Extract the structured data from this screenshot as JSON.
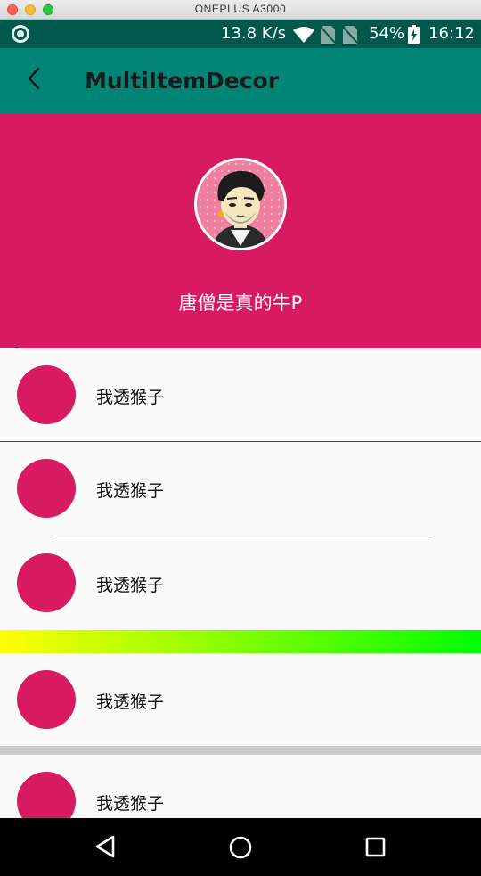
{
  "window": {
    "title": "ONEPLUS A3000"
  },
  "status_bar": {
    "net_speed": "13.8 K/s",
    "battery_percent": "54%",
    "time": "16:12",
    "icons": [
      "record-icon",
      "wifi-icon",
      "sim-off-icon",
      "sim-off-icon",
      "battery-charging-icon"
    ]
  },
  "app_bar": {
    "title": "MultiItemDecor",
    "back_icon": "chevron-left-icon"
  },
  "header": {
    "name": "唐僧是真的牛P",
    "avatar_icon": "cartoon-avatar"
  },
  "list": {
    "items": [
      {
        "label": "我透猴子"
      },
      {
        "label": "我透猴子"
      },
      {
        "label": "我透猴子"
      },
      {
        "label": "我透猴子"
      },
      {
        "label": "我透猴子"
      }
    ]
  },
  "colors": {
    "status_bar": "#00574b",
    "app_bar": "#008577",
    "accent": "#d81b60",
    "divider_green": "#2ecc40",
    "divider_gray": "#cccccc",
    "gradient_start": "#ffff00",
    "gradient_end": "#00ff00"
  },
  "nav_bar": {
    "icons": [
      "back-triangle-icon",
      "home-circle-icon",
      "recents-square-icon"
    ]
  }
}
